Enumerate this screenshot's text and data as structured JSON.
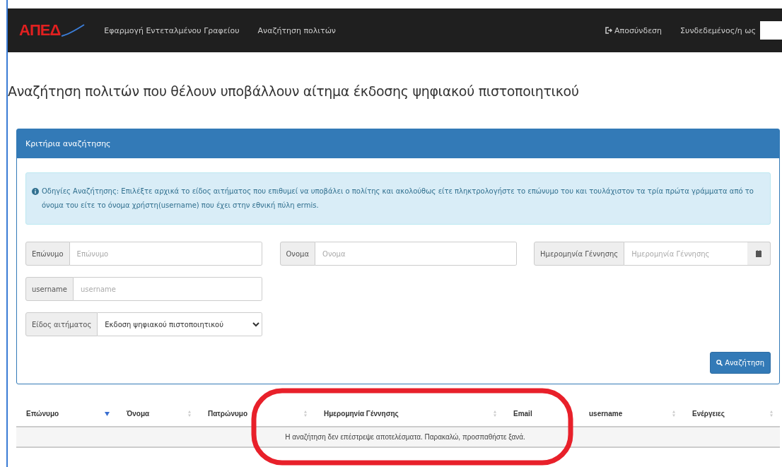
{
  "navbar": {
    "logo": "ΑΠΕΔ",
    "links": [
      {
        "label": "Εφαρμογή Εντεταλμένου Γραφείου"
      },
      {
        "label": "Αναζήτηση πολιτών"
      }
    ],
    "logout": "Αποσύνδεση",
    "user_label": "Συνδεδεμένος/η ως"
  },
  "page_title": "Αναζήτηση πολιτών που θέλουν υποβάλλουν αίτημα έκδοσης ψηφιακού πιστοποιητικού",
  "panel": {
    "title": "Κριτήρια αναζήτησης",
    "info": "Οδηγίες Αναζήτησης: Επιλέξτε αρχικά το είδος αιτήματος που επιθυμεί να υποβάλει ο πολίτης και ακολούθως είτε πληκτρολογήστε το επώνυμο του και τουλάχιστον τα τρία πρώτα γράμματα από το όνομα του είτε το όνομα χρήστη(username) που έχει στην εθνική πύλη ermis.",
    "fields": [
      {
        "kind": "text",
        "label": "Επώνυμο",
        "placeholder": "Επώνυμο"
      },
      {
        "kind": "text",
        "label": "Ονομα",
        "placeholder": "Ονομα"
      },
      {
        "kind": "date",
        "label": "Ημερομηνία Γέννησης",
        "placeholder": "Ημερομηνία Γέννησης"
      },
      {
        "kind": "text",
        "label": "username",
        "placeholder": "username"
      },
      {
        "kind": "select",
        "label": "Είδος αιτήματος",
        "value": "Εκδοση ψηφιακού πιστοποιητικού"
      }
    ],
    "search_button": "Αναζήτηση"
  },
  "table": {
    "columns": [
      {
        "label": "Επώνυμο",
        "sorted": true
      },
      {
        "label": "Όνομα",
        "sorted": false
      },
      {
        "label": "Πατρώνυμο",
        "sorted": false
      },
      {
        "label": "Ημερομηνία Γέννησης",
        "sorted": false
      },
      {
        "label": "Email",
        "sorted": false
      },
      {
        "label": "username",
        "sorted": false
      },
      {
        "label": "Ενέργειες",
        "sorted": false
      }
    ],
    "empty_message": "Η αναζήτηση δεν επέστρεψε αποτελέσματα. Παρακαλώ, προσπαθήστε ξανά."
  },
  "annotation": {
    "kind": "ellipse"
  }
}
